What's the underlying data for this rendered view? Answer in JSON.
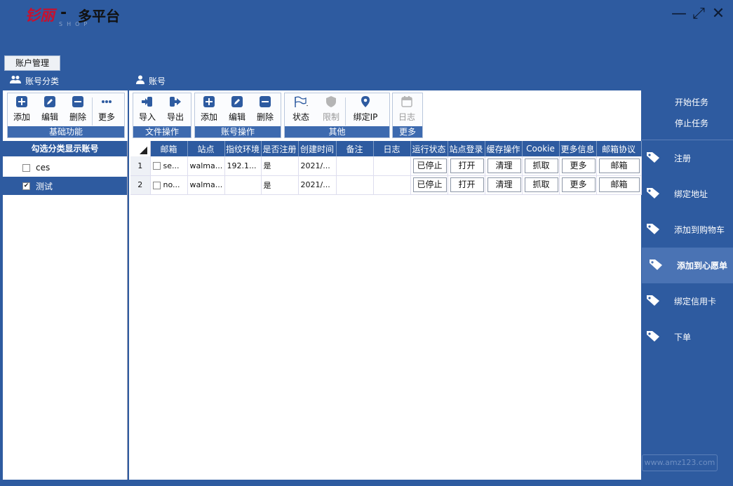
{
  "window": {
    "logo_text": "钐丽",
    "logo_sub": "SHOP",
    "dash": "-",
    "title": "多平台",
    "controls": {
      "minimize": "—",
      "maximize": "⤢",
      "close": "✕"
    }
  },
  "tab": {
    "label": "账户管理"
  },
  "left_header": {
    "title": "账号分类"
  },
  "main_header": {
    "title": "账号"
  },
  "toolbar": {
    "basic": {
      "footer": "基础功能",
      "add": "添加",
      "edit": "编辑",
      "delete": "删除",
      "more": "更多"
    },
    "file": {
      "footer": "文件操作",
      "import": "导入",
      "export": "导出"
    },
    "account": {
      "footer": "账号操作",
      "add": "添加",
      "edit": "编辑",
      "delete": "删除"
    },
    "other": {
      "footer": "其他",
      "status": "状态",
      "limit": "限制",
      "bind_ip": "绑定IP"
    },
    "more": {
      "footer": "更多",
      "log": "日志"
    }
  },
  "categories": {
    "header": "勾选分类显示账号",
    "items": [
      {
        "label": "ces",
        "checked": false
      },
      {
        "label": "测试",
        "checked": true
      }
    ]
  },
  "grid": {
    "columns": [
      "邮箱",
      "站点",
      "指纹环境",
      "是否注册",
      "创建时间",
      "备注",
      "日志",
      "运行状态",
      "站点登录",
      "缓存操作",
      "Cookie",
      "更多信息",
      "邮箱协议"
    ],
    "rows": [
      {
        "num": "1",
        "email": "se...",
        "site": "walma...",
        "env": "192.1...",
        "registered": "是",
        "created": "2021/...",
        "note": "",
        "log": "",
        "run": "已停止",
        "login": "打开",
        "cache": "清理",
        "cookie": "抓取",
        "more": "更多",
        "proto": "邮箱"
      },
      {
        "num": "2",
        "email": "no...",
        "site": "walma...",
        "env": "",
        "registered": "是",
        "created": "2021/...",
        "note": "",
        "log": "",
        "run": "已停止",
        "login": "打开",
        "cache": "清理",
        "cookie": "抓取",
        "more": "更多",
        "proto": "邮箱"
      }
    ]
  },
  "tasks": {
    "start": "开始任务",
    "stop": "停止任务"
  },
  "actions": [
    {
      "label": "注册",
      "active": false
    },
    {
      "label": "绑定地址",
      "active": false
    },
    {
      "label": "添加到购物车",
      "active": false
    },
    {
      "label": "添加到心愿单",
      "active": true
    },
    {
      "label": "绑定信用卡",
      "active": false
    },
    {
      "label": "下单",
      "active": false
    }
  ],
  "watermark": "www.amz123.com"
}
